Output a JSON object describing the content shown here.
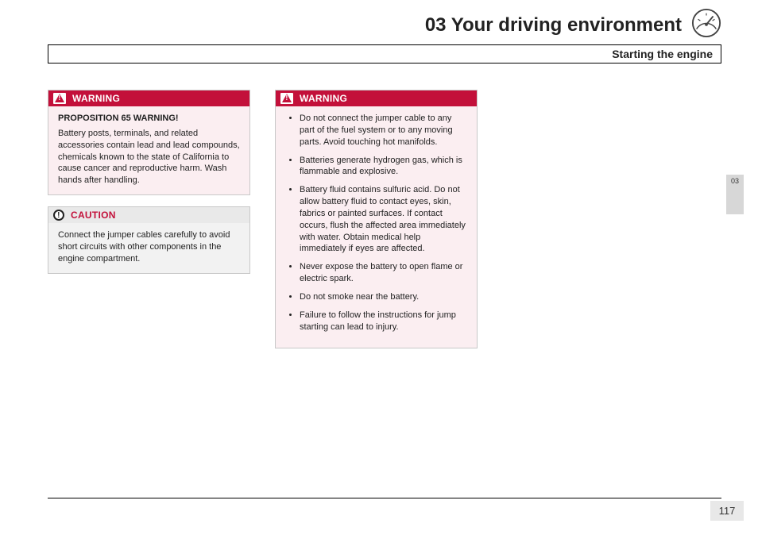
{
  "header": {
    "chapter_title": "03 Your driving environment",
    "section_title": "Starting the engine"
  },
  "side_tab": {
    "label": "03"
  },
  "page_number": "117",
  "col_left": {
    "warning1": {
      "label": "WARNING",
      "subhead": "PROPOSITION 65 WARNING!",
      "body": "Battery posts, terminals, and related accessories contain lead and lead compounds, chemicals known to the state of California to cause cancer and reproductive harm. Wash hands after handling."
    },
    "caution": {
      "label": "CAUTION",
      "body": "Connect the jumper cables carefully to avoid short circuits with other components in the engine compartment."
    }
  },
  "col_mid": {
    "warning2": {
      "label": "WARNING",
      "items": [
        "Do not connect the jumper cable to any part of the fuel system or to any moving parts. Avoid touching hot manifolds.",
        "Batteries generate hydrogen gas, which is flammable and explosive.",
        "Battery fluid contains sulfuric acid. Do not allow battery fluid to contact eyes, skin, fabrics or painted surfaces. If contact occurs, flush the affected area immediately with water. Obtain medical help immediately if eyes are affected.",
        "Never expose the battery to open flame or electric spark.",
        "Do not smoke near the battery.",
        "Failure to follow the instructions for jump starting can lead to injury."
      ]
    }
  }
}
